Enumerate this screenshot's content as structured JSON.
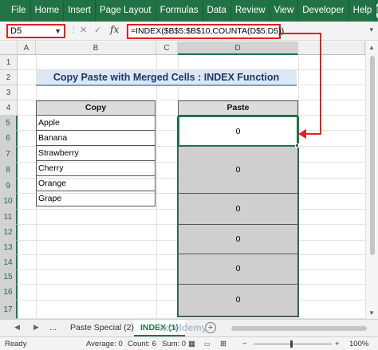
{
  "ribbon": {
    "tabs": [
      "File",
      "Home",
      "Insert",
      "Page Layout",
      "Formulas",
      "Data",
      "Review",
      "View",
      "Developer",
      "Help"
    ],
    "share_icon": "comment-icon"
  },
  "formula_bar": {
    "name_box": "D5",
    "cancel": "✕",
    "enter": "✓",
    "fx": "fx",
    "formula": "=INDEX($B$5:$B$10,COUNTA(D$5:D5))"
  },
  "grid": {
    "columns": [
      "A",
      "B",
      "C",
      "D"
    ],
    "rows": [
      "1",
      "2",
      "3",
      "4",
      "5",
      "6",
      "7",
      "8",
      "9",
      "10",
      "11",
      "12",
      "13",
      "14",
      "15",
      "16",
      "17"
    ],
    "selected_column": "D",
    "title": "Copy Paste with Merged Cells : INDEX Function",
    "copy_header": "Copy",
    "paste_header": "Paste",
    "copy_values": [
      "Apple",
      "Banana",
      "Strawberry",
      "Cherry",
      "Orange",
      "Grape"
    ],
    "paste_values": [
      "0",
      "0",
      "0",
      "0",
      "0",
      "0"
    ]
  },
  "sheet_tabs": {
    "more": "...",
    "tabs": [
      "Paste Special (2)",
      "INDEX (1)"
    ],
    "active": "INDEX (1)",
    "add": "+"
  },
  "watermark": "exceldemy",
  "status_bar": {
    "ready": "Ready",
    "average": "Average: 0",
    "count": "Count: 6",
    "sum": "Sum: 0",
    "zoom": "100%"
  },
  "colors": {
    "accent": "#217346",
    "highlight": "#e02020",
    "title_bg": "#dde6f2"
  }
}
